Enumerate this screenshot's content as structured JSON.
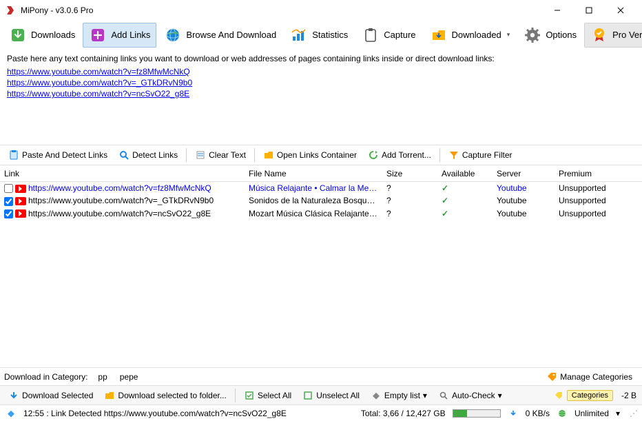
{
  "window": {
    "title": "MiPony - v3.0.6 Pro"
  },
  "toolbar": {
    "downloads": "Downloads",
    "add_links": "Add Links",
    "browse": "Browse And Download",
    "statistics": "Statistics",
    "capture": "Capture",
    "downloaded": "Downloaded",
    "options": "Options",
    "pro": "Pro Version"
  },
  "paste": {
    "instruction": "Paste here any text containing links you want to download or web addresses of pages containing links inside or direct download links:",
    "links": [
      "https://www.youtube.com/watch?v=fz8MfwMcNkQ",
      "https://www.youtube.com/watch?v=_GTkDRvN9b0",
      "https://www.youtube.com/watch?v=ncSvO22_g8E"
    ]
  },
  "toolbar2": {
    "paste_detect": "Paste And Detect Links",
    "detect": "Detect Links",
    "clear": "Clear Text",
    "open_container": "Open Links Container",
    "add_torrent": "Add Torrent...",
    "capture_filter": "Capture Filter"
  },
  "columns": {
    "link": "Link",
    "filename": "File Name",
    "size": "Size",
    "available": "Available",
    "server": "Server",
    "premium": "Premium"
  },
  "rows": [
    {
      "checked": false,
      "link": "https://www.youtube.com/watch?v=fz8MfwMcNkQ",
      "filename": "Música Relajante • Calmar la Mente, ...",
      "size": "?",
      "available": "✓",
      "server": "Youtube",
      "premium": "Unsupported",
      "link_color": "blue",
      "filename_color": "blue",
      "server_color": "blue"
    },
    {
      "checked": true,
      "link": "https://www.youtube.com/watch?v=_GTkDRvN9b0",
      "filename": "Sonidos de la Naturaleza Bosque Rel...",
      "size": "?",
      "available": "✓",
      "server": "Youtube",
      "premium": "Unsupported",
      "link_color": "black",
      "filename_color": "black",
      "server_color": "black"
    },
    {
      "checked": true,
      "link": "https://www.youtube.com/watch?v=ncSvO22_g8E",
      "filename": "Mozart Música Clásica Relajante para ...",
      "size": "?",
      "available": "✓",
      "server": "Youtube",
      "premium": "Unsupported",
      "link_color": "black",
      "filename_color": "black",
      "server_color": "black"
    }
  ],
  "catbar": {
    "label": "Download in Category:",
    "categories": [
      "pp",
      "pepe"
    ],
    "manage": "Manage Categories"
  },
  "toolbar3": {
    "download_selected": "Download Selected",
    "download_folder": "Download selected to folder...",
    "select_all": "Select All",
    "unselect_all": "Unselect All",
    "empty_list": "Empty list",
    "auto_check": "Auto-Check",
    "categories": "Categories",
    "neg2b": "-2 B"
  },
  "status": {
    "message": "12:55 : Link Detected https://www.youtube.com/watch?v=ncSvO22_g8E",
    "total": "Total: 3,66 / 12,427 GB",
    "progress_pct": 30,
    "speed": "0 KB/s",
    "unlimited": "Unlimited"
  }
}
